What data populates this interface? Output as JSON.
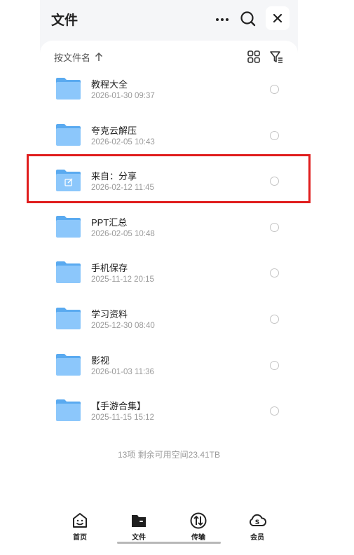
{
  "header": {
    "title": "文件",
    "icons": [
      "more-icon",
      "search-icon",
      "close-icon"
    ]
  },
  "toolbar": {
    "sort_label": "按文件名",
    "sort_direction": "ascending",
    "icons": [
      "grid-view-icon",
      "filter-icon"
    ]
  },
  "files": [
    {
      "name": "教程大全",
      "date": "2026-01-30 09:37",
      "shared": false
    },
    {
      "name": "夸克云解压",
      "date": "2026-02-05 10:43",
      "shared": false
    },
    {
      "name": "来自：分享",
      "date": "2026-02-12 11:45",
      "shared": true
    },
    {
      "name": "PPT汇总",
      "date": "2026-02-05 10:48",
      "shared": false
    },
    {
      "name": "手机保存",
      "date": "2025-11-12 20:15",
      "shared": false
    },
    {
      "name": "学习资料",
      "date": "2025-12-30 08:40",
      "shared": false
    },
    {
      "name": "影视",
      "date": "2026-01-03 11:36",
      "shared": false
    },
    {
      "name": "【手游合集】",
      "date": "2025-11-15 15:12",
      "shared": false
    }
  ],
  "footer": {
    "summary": "13项 剩余可用空间23.41TB"
  },
  "tabbar": {
    "items": [
      {
        "label": "首页",
        "icon": "home-smile-icon",
        "active": false
      },
      {
        "label": "文件",
        "icon": "folder-icon",
        "active": true
      },
      {
        "label": "传输",
        "icon": "transfer-icon",
        "active": false
      },
      {
        "label": "会员",
        "icon": "cloud-vip-icon",
        "active": false
      }
    ]
  },
  "colors": {
    "folder": "#5aaaf0",
    "folder_light": "#8cc7fb",
    "highlight": "#e01d1d"
  }
}
